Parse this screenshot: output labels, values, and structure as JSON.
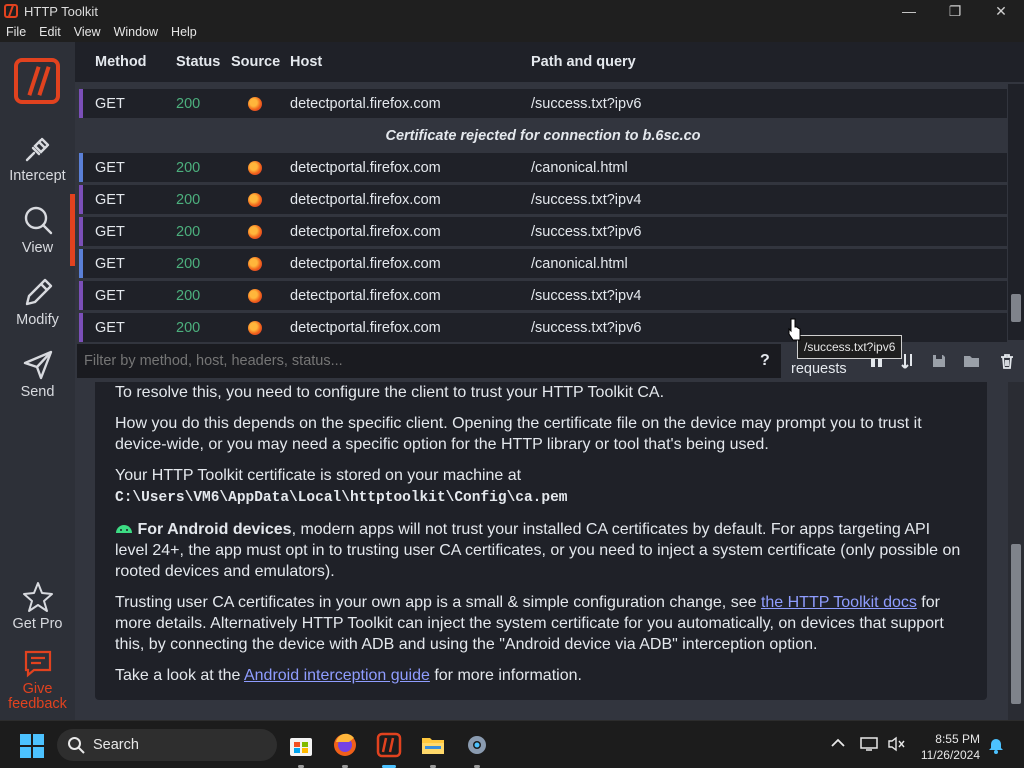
{
  "window": {
    "title": "HTTP Toolkit"
  },
  "menu": [
    "File",
    "Edit",
    "View",
    "Window",
    "Help"
  ],
  "sidebar": {
    "items": [
      {
        "label": "Intercept",
        "icon": "plug-icon"
      },
      {
        "label": "View",
        "icon": "search-icon"
      },
      {
        "label": "Modify",
        "icon": "pencil-icon"
      },
      {
        "label": "Send",
        "icon": "send-icon"
      },
      {
        "label": "Get Pro",
        "icon": "star-icon"
      },
      {
        "label": "Give feedback",
        "icon": "feedback-icon"
      }
    ]
  },
  "table": {
    "headers": [
      "Method",
      "Status",
      "Source",
      "Host",
      "Path and query"
    ],
    "rows": [
      {
        "method": "GET",
        "status": "200",
        "host": "detectportal.firefox.com",
        "path": "/success.txt?ipv6",
        "edge": "#7b4fb8"
      },
      {
        "notice": "Certificate rejected for connection to b.6sc.co"
      },
      {
        "method": "GET",
        "status": "200",
        "host": "detectportal.firefox.com",
        "path": "/canonical.html",
        "edge": "#5a7fd6"
      },
      {
        "method": "GET",
        "status": "200",
        "host": "detectportal.firefox.com",
        "path": "/success.txt?ipv4",
        "edge": "#7b4fb8"
      },
      {
        "method": "GET",
        "status": "200",
        "host": "detectportal.firefox.com",
        "path": "/success.txt?ipv6",
        "edge": "#7b4fb8"
      },
      {
        "method": "GET",
        "status": "200",
        "host": "detectportal.firefox.com",
        "path": "/canonical.html",
        "edge": "#5a7fd6"
      },
      {
        "method": "GET",
        "status": "200",
        "host": "detectportal.firefox.com",
        "path": "/success.txt?ipv4",
        "edge": "#7b4fb8"
      },
      {
        "method": "GET",
        "status": "200",
        "host": "detectportal.firefox.com",
        "path": "/success.txt?ipv6",
        "edge": "#7b4fb8"
      }
    ]
  },
  "filter": {
    "placeholder": "Filter by method, host, headers, status...",
    "help": "?",
    "count_label": "requests"
  },
  "tooltip": "/success.txt?ipv6",
  "details": {
    "p1": "To resolve this, you need to configure the client to trust your HTTP Toolkit CA.",
    "p2": "How you do this depends on the specific client. Opening the certificate file on the device may prompt you to trust it device-wide, or you may need a specific option for the HTTP library or tool that's being used.",
    "p3_text": "Your HTTP Toolkit certificate is stored on your machine at",
    "p3_path": "C:\\Users\\VM6\\AppData\\Local\\httptoolkit\\Config\\ca.pem",
    "p4_bold": "For Android devices",
    "p4_rest": ", modern apps will not trust your installed CA certificates by default. For apps targeting API level 24+, the app must opt in to trusting user CA certificates, or you need to inject a system certificate (only possible on rooted devices and emulators).",
    "p5_pre": "Trusting user CA certificates in your own app is a small & simple configuration change, see ",
    "p5_link": "the HTTP Toolkit docs",
    "p5_post": " for more details. Alternatively HTTP Toolkit can inject the system certificate for you automatically, on devices that support this, by connecting the device with ADB and using the \"Android device via ADB\" interception option.",
    "p6_pre": "Take a look at the ",
    "p6_link": "Android interception guide",
    "p6_post": " for more information."
  },
  "taskbar": {
    "search": "Search",
    "time": "8:55 PM",
    "date": "11/26/2024"
  },
  "colors": {
    "accent": "#e1421f",
    "status_ok": "#4caf7d",
    "link": "#8f9dff"
  }
}
